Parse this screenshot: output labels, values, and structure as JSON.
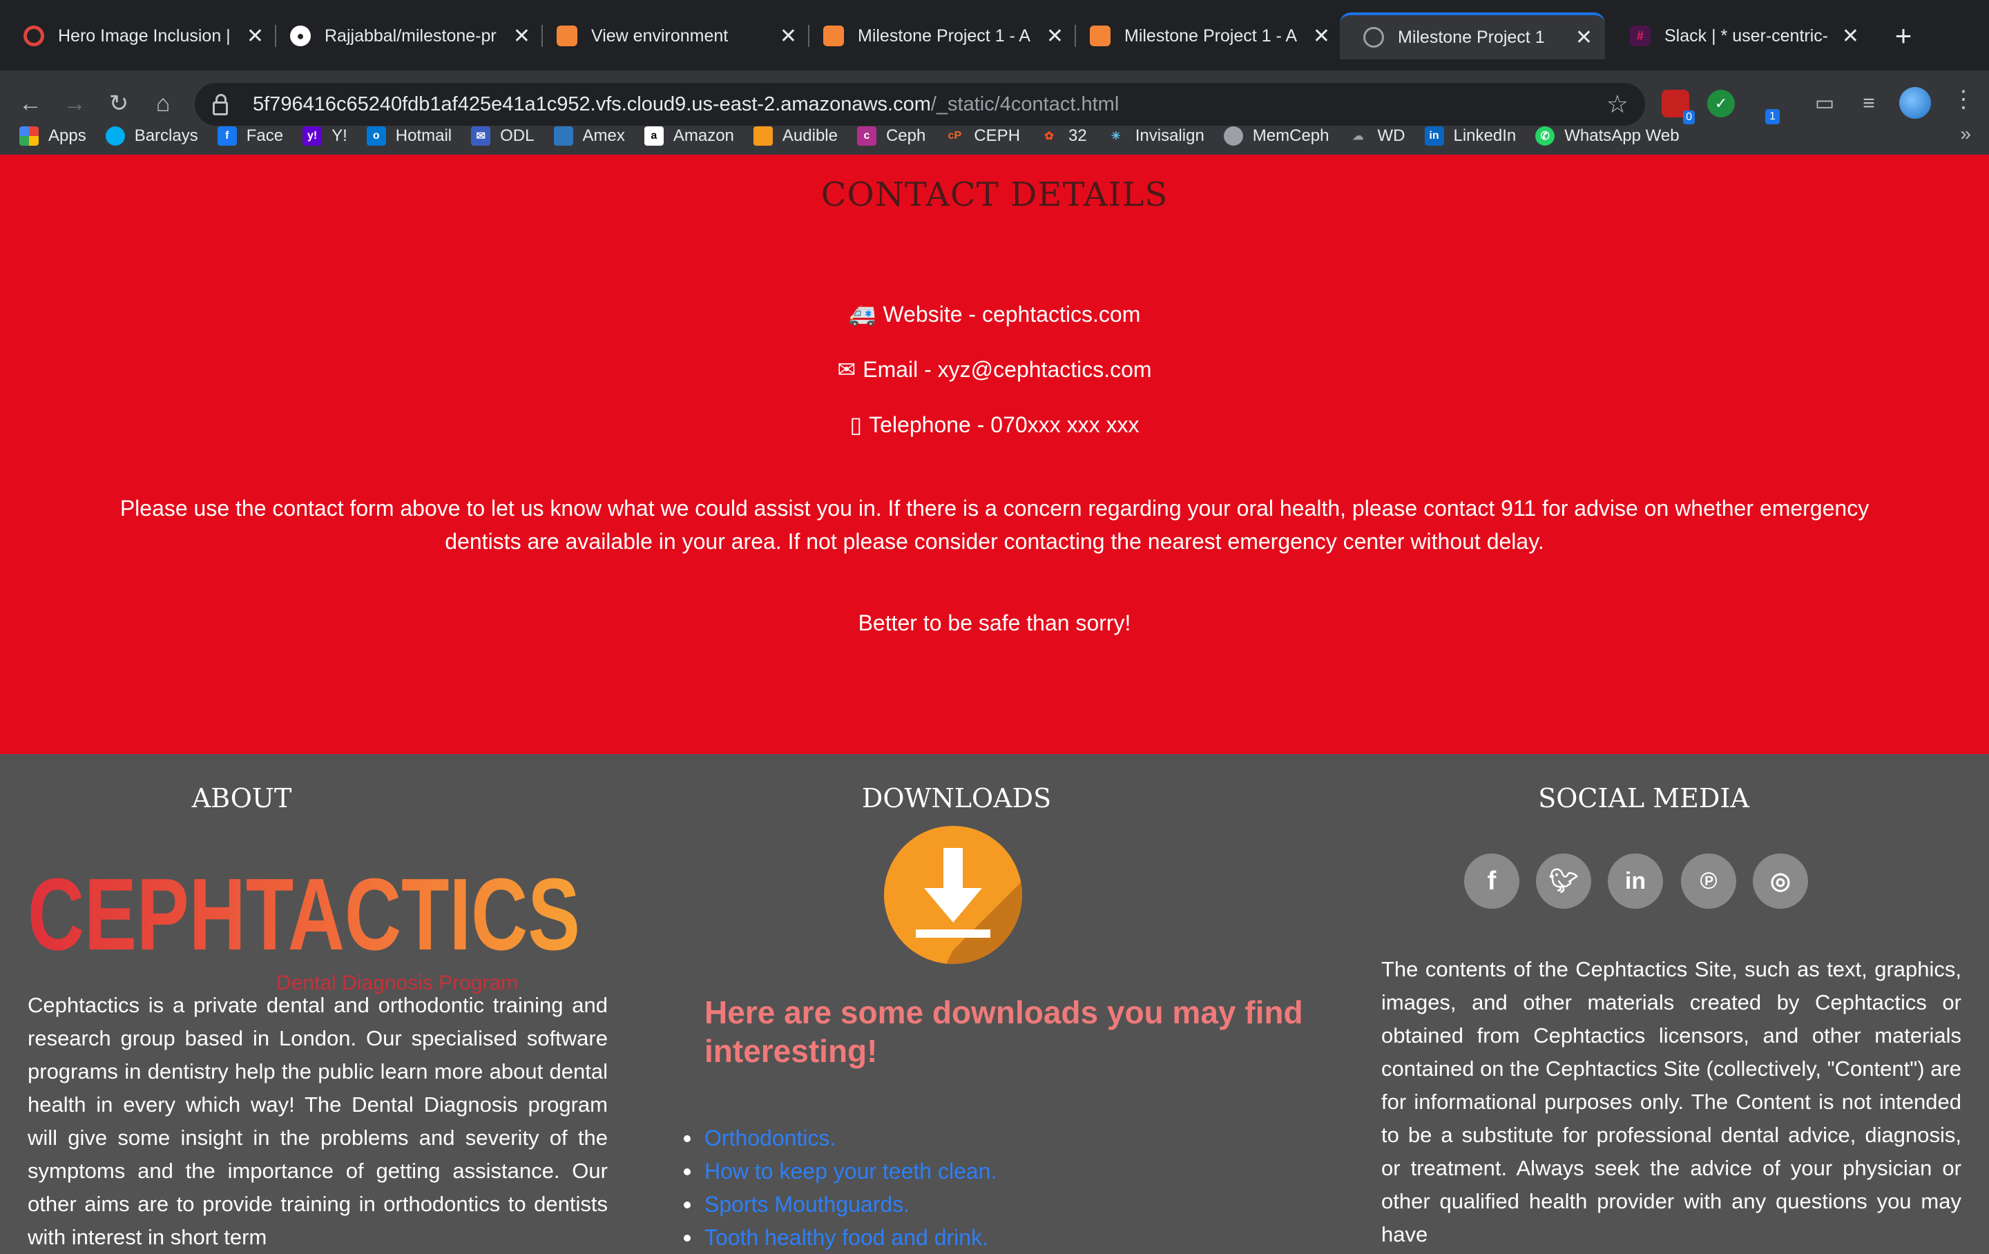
{
  "browser": {
    "tabs": [
      {
        "title": "Hero Image Inclusion |",
        "icon": "opera-icon",
        "color": "#e0443e"
      },
      {
        "title": "Rajjabbal/milestone-pr",
        "icon": "github-icon",
        "color": "#ffffff"
      },
      {
        "title": "View environment",
        "icon": "aws-cloud9-icon",
        "color": "#f58536"
      },
      {
        "title": "Milestone Project 1 - A",
        "icon": "aws-cloud9-icon",
        "color": "#f58536"
      },
      {
        "title": "Milestone Project 1 - A",
        "icon": "aws-cloud9-icon",
        "color": "#f58536"
      },
      {
        "title": "Milestone Project 1",
        "icon": "globe-icon",
        "color": "#9aa0a6"
      },
      {
        "title": "Slack | * user-centric-",
        "icon": "slack-icon",
        "color": "#e01e5a"
      }
    ],
    "url_host": "5f796416c65240fdb1af425e41a1c952.vfs.cloud9.us-east-2.amazonaws.com",
    "url_path": "/_static/4contact.html",
    "ext_badges": [
      "0",
      "1"
    ],
    "bookmarks": [
      "Apps",
      "Barclays",
      "Face",
      "Y!",
      "Hotmail",
      "ODL",
      "Amex",
      "Amazon",
      "Audible",
      "Ceph",
      "CEPH",
      "32",
      "Invisalign",
      "MemCeph",
      "WD",
      "LinkedIn",
      "WhatsApp Web"
    ]
  },
  "contact": {
    "title": "CONTACT DETAILS",
    "website": "Website - cephtactics.com",
    "email": "Email - xyz@cephtactics.com",
    "telephone": "Telephone - 070xxx xxx xxx",
    "paragraph": "Please use the contact form above to let us know what we could assist you in. If there is a concern regarding your oral health, please contact 911 for advise on whether emergency dentists are available in your area. If not please consider contacting the nearest emergency center without delay.",
    "safe": "Better to be safe than sorry!"
  },
  "footer": {
    "about": {
      "heading": "ABOUT",
      "logo_text": "CEPHTACTICS",
      "logo_tagline": "Dental Diagnosis Program",
      "text": "Cephtactics is a private dental and orthodontic training and research group based in London. Our specialised software programs in dentistry help the public learn more about dental health in every which way! The Dental Diagnosis program will give some insight in the problems and severity of the symptoms and the importance of getting assistance. Our other aims are to provide training in orthodontics to dentists with interest in short term"
    },
    "downloads": {
      "heading": "DOWNLOADS",
      "intro": "Here are some downloads you may find interesting!",
      "items": [
        "Orthodontics.",
        "How to keep your teeth clean.",
        "Sports Mouthguards.",
        "Tooth healthy food and drink."
      ]
    },
    "social": {
      "heading": "SOCIAL MEDIA",
      "icons": [
        "f",
        "t",
        "in",
        "p",
        "ig"
      ],
      "text": "The contents of the Cephtactics Site, such as text, graphics, images, and other materials created by Cephtactics or obtained from Cephtactics licensors, and other materials contained on the Cephtactics Site (collectively, \"Content\") are for informational purposes only. The Content is not intended to be a substitute for professional dental advice, diagnosis, or treatment. Always seek the advice of your physician or other qualified health provider with any questions you may have"
    }
  }
}
